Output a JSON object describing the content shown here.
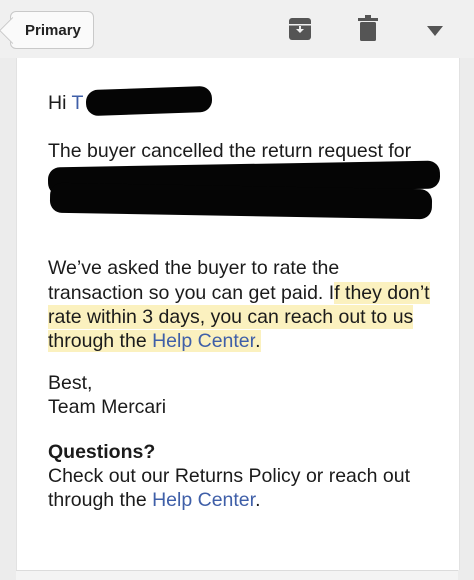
{
  "toolbar": {
    "back_label": "Primary",
    "icons": [
      "archive-icon",
      "trash-icon",
      "dropdown-icon"
    ]
  },
  "email": {
    "greeting": "Hi",
    "greeting_initial": "T",
    "paragraph1": "The buyer cancelled the return request for",
    "paragraph2": {
      "line1": "We’ve asked the buyer to rate the",
      "line2_plain": "transaction so you can get paid. I",
      "line2_highlight": "f they don’t",
      "line3": "rate within 3 days, you can reach out to us",
      "line4_prefix": "through the ",
      "line4_link": "Help Center",
      "line4_suffix": "."
    },
    "signoff": "Best,",
    "signature": "Team Mercari",
    "questions_heading": "Questions?",
    "questions_line1": "Check out our Returns Policy or reach out",
    "questions_line2_prefix": "through the ",
    "questions_link": "Help Center",
    "questions_line2_suffix": "."
  },
  "colors": {
    "link": "#3f5fa8",
    "highlight": "#faecaa",
    "redaction": "#050505"
  }
}
